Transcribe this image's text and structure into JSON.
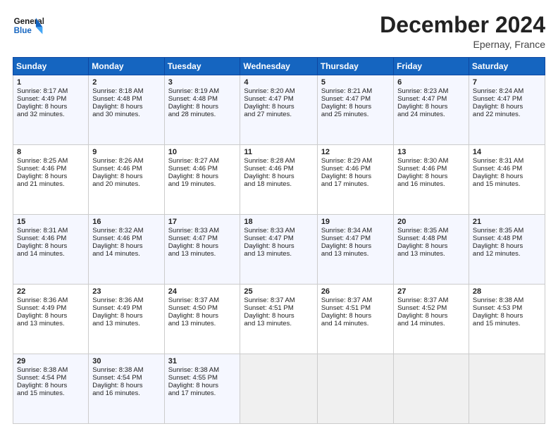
{
  "header": {
    "logo_line1": "General",
    "logo_line2": "Blue",
    "month": "December 2024",
    "location": "Epernay, France"
  },
  "weekdays": [
    "Sunday",
    "Monday",
    "Tuesday",
    "Wednesday",
    "Thursday",
    "Friday",
    "Saturday"
  ],
  "weeks": [
    [
      {
        "day": "1",
        "info": "Sunrise: 8:17 AM\nSunset: 4:49 PM\nDaylight: 8 hours\nand 32 minutes."
      },
      {
        "day": "2",
        "info": "Sunrise: 8:18 AM\nSunset: 4:48 PM\nDaylight: 8 hours\nand 30 minutes."
      },
      {
        "day": "3",
        "info": "Sunrise: 8:19 AM\nSunset: 4:48 PM\nDaylight: 8 hours\nand 28 minutes."
      },
      {
        "day": "4",
        "info": "Sunrise: 8:20 AM\nSunset: 4:47 PM\nDaylight: 8 hours\nand 27 minutes."
      },
      {
        "day": "5",
        "info": "Sunrise: 8:21 AM\nSunset: 4:47 PM\nDaylight: 8 hours\nand 25 minutes."
      },
      {
        "day": "6",
        "info": "Sunrise: 8:23 AM\nSunset: 4:47 PM\nDaylight: 8 hours\nand 24 minutes."
      },
      {
        "day": "7",
        "info": "Sunrise: 8:24 AM\nSunset: 4:47 PM\nDaylight: 8 hours\nand 22 minutes."
      }
    ],
    [
      {
        "day": "8",
        "info": "Sunrise: 8:25 AM\nSunset: 4:46 PM\nDaylight: 8 hours\nand 21 minutes."
      },
      {
        "day": "9",
        "info": "Sunrise: 8:26 AM\nSunset: 4:46 PM\nDaylight: 8 hours\nand 20 minutes."
      },
      {
        "day": "10",
        "info": "Sunrise: 8:27 AM\nSunset: 4:46 PM\nDaylight: 8 hours\nand 19 minutes."
      },
      {
        "day": "11",
        "info": "Sunrise: 8:28 AM\nSunset: 4:46 PM\nDaylight: 8 hours\nand 18 minutes."
      },
      {
        "day": "12",
        "info": "Sunrise: 8:29 AM\nSunset: 4:46 PM\nDaylight: 8 hours\nand 17 minutes."
      },
      {
        "day": "13",
        "info": "Sunrise: 8:30 AM\nSunset: 4:46 PM\nDaylight: 8 hours\nand 16 minutes."
      },
      {
        "day": "14",
        "info": "Sunrise: 8:31 AM\nSunset: 4:46 PM\nDaylight: 8 hours\nand 15 minutes."
      }
    ],
    [
      {
        "day": "15",
        "info": "Sunrise: 8:31 AM\nSunset: 4:46 PM\nDaylight: 8 hours\nand 14 minutes."
      },
      {
        "day": "16",
        "info": "Sunrise: 8:32 AM\nSunset: 4:46 PM\nDaylight: 8 hours\nand 14 minutes."
      },
      {
        "day": "17",
        "info": "Sunrise: 8:33 AM\nSunset: 4:47 PM\nDaylight: 8 hours\nand 13 minutes."
      },
      {
        "day": "18",
        "info": "Sunrise: 8:33 AM\nSunset: 4:47 PM\nDaylight: 8 hours\nand 13 minutes."
      },
      {
        "day": "19",
        "info": "Sunrise: 8:34 AM\nSunset: 4:47 PM\nDaylight: 8 hours\nand 13 minutes."
      },
      {
        "day": "20",
        "info": "Sunrise: 8:35 AM\nSunset: 4:48 PM\nDaylight: 8 hours\nand 13 minutes."
      },
      {
        "day": "21",
        "info": "Sunrise: 8:35 AM\nSunset: 4:48 PM\nDaylight: 8 hours\nand 12 minutes."
      }
    ],
    [
      {
        "day": "22",
        "info": "Sunrise: 8:36 AM\nSunset: 4:49 PM\nDaylight: 8 hours\nand 13 minutes."
      },
      {
        "day": "23",
        "info": "Sunrise: 8:36 AM\nSunset: 4:49 PM\nDaylight: 8 hours\nand 13 minutes."
      },
      {
        "day": "24",
        "info": "Sunrise: 8:37 AM\nSunset: 4:50 PM\nDaylight: 8 hours\nand 13 minutes."
      },
      {
        "day": "25",
        "info": "Sunrise: 8:37 AM\nSunset: 4:51 PM\nDaylight: 8 hours\nand 13 minutes."
      },
      {
        "day": "26",
        "info": "Sunrise: 8:37 AM\nSunset: 4:51 PM\nDaylight: 8 hours\nand 14 minutes."
      },
      {
        "day": "27",
        "info": "Sunrise: 8:37 AM\nSunset: 4:52 PM\nDaylight: 8 hours\nand 14 minutes."
      },
      {
        "day": "28",
        "info": "Sunrise: 8:38 AM\nSunset: 4:53 PM\nDaylight: 8 hours\nand 15 minutes."
      }
    ],
    [
      {
        "day": "29",
        "info": "Sunrise: 8:38 AM\nSunset: 4:54 PM\nDaylight: 8 hours\nand 15 minutes."
      },
      {
        "day": "30",
        "info": "Sunrise: 8:38 AM\nSunset: 4:54 PM\nDaylight: 8 hours\nand 16 minutes."
      },
      {
        "day": "31",
        "info": "Sunrise: 8:38 AM\nSunset: 4:55 PM\nDaylight: 8 hours\nand 17 minutes."
      },
      {
        "day": "",
        "info": ""
      },
      {
        "day": "",
        "info": ""
      },
      {
        "day": "",
        "info": ""
      },
      {
        "day": "",
        "info": ""
      }
    ]
  ]
}
